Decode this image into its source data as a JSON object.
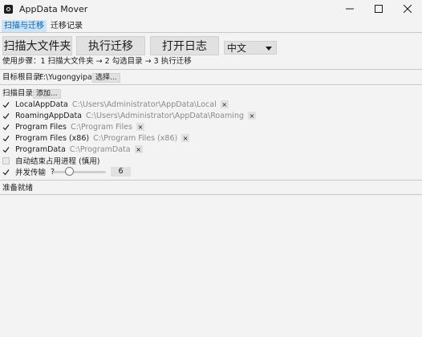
{
  "window": {
    "title": "AppData Mover"
  },
  "menu": {
    "tabs": [
      {
        "label": "扫描与迁移"
      },
      {
        "label": "迁移记录"
      }
    ]
  },
  "toolbar": {
    "scan_label": "扫描大文件夹",
    "migrate_label": "执行迁移",
    "open_log_label": "打开日志",
    "language": "中文"
  },
  "steps": "使用步骤：1 扫描大文件夹 → 2 勾选目录 → 3 执行迁移",
  "target": {
    "label": "目标根目录:",
    "value": "F:\\Yugongyipan",
    "choose_label": "选择..."
  },
  "scan_dirs": {
    "label": "扫描目录:",
    "add_label": "添加...",
    "items": [
      {
        "name": "LocalAppData",
        "path": "C:\\Users\\Administrator\\AppData\\Local",
        "checked": true
      },
      {
        "name": "RoamingAppData",
        "path": "C:\\Users\\Administrator\\AppData\\Roaming",
        "checked": true
      },
      {
        "name": "Program Files",
        "path": "C:\\Program Files",
        "checked": true
      },
      {
        "name": "Program Files (x86)",
        "path": "C:\\Program Files (x86)",
        "checked": true
      },
      {
        "name": "ProgramData",
        "path": "C:\\ProgramData",
        "checked": true
      }
    ],
    "remove_label": "×"
  },
  "options": {
    "auto_kill_label": "自动结束占用进程 (慎用)",
    "auto_kill_checked": false,
    "concurrent_label": "并发传输",
    "concurrent_help": "?",
    "concurrent_checked": true,
    "concurrency": "6",
    "concurrency_level": 0.3
  },
  "status": "准备就绪",
  "colors": {
    "accent": "#005fb8",
    "tab_active_bg": "#cce4f7",
    "button_bg": "#e1e1e1"
  }
}
